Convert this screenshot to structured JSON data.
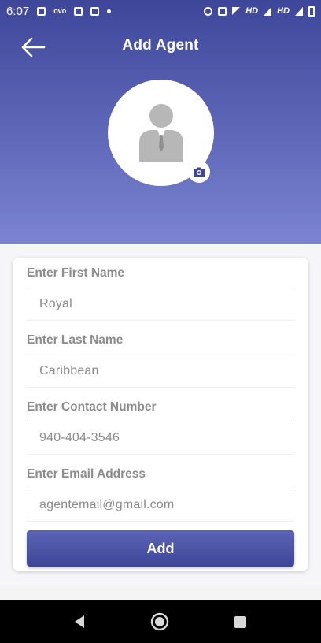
{
  "status_bar": {
    "time": "6:07",
    "network_labels": [
      "HD",
      "HD"
    ],
    "icons": [
      "notification-icon",
      "ovo-icon",
      "calendar-icon",
      "notification-icon",
      "dot-icon",
      "alarm-icon",
      "vibrate-icon",
      "wifi-icon",
      "signal-icon",
      "signal-icon",
      "battery-icon"
    ]
  },
  "header": {
    "title": "Add Agent",
    "back_icon": "arrow-left-icon",
    "avatar_icon": "person-avatar-icon",
    "camera_icon": "camera-icon"
  },
  "form": {
    "fields": [
      {
        "label": "Enter First Name",
        "value": "Royal"
      },
      {
        "label": "Enter Last Name",
        "value": "Caribbean"
      },
      {
        "label": "Enter Contact Number",
        "value": "940-404-3546"
      },
      {
        "label": "Enter Email Address",
        "value": "agentemail@gmail.com"
      }
    ],
    "submit_label": "Add"
  },
  "nav_bar": {
    "icons": [
      "back-triangle-icon",
      "home-circle-icon",
      "recents-square-icon"
    ]
  },
  "colors": {
    "accent_dark": "#3e4699",
    "accent_light": "#7b84d2",
    "label_gray": "#8c8c8c"
  }
}
